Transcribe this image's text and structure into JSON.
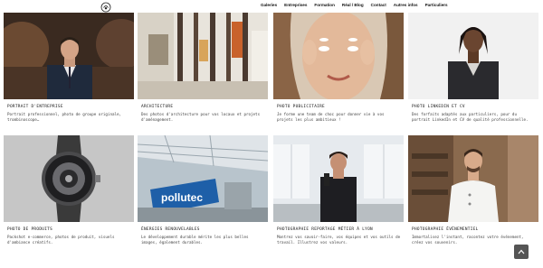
{
  "nav": [
    "Galeries",
    "Entreprises",
    "Formation",
    "Réal / Blog",
    "Contact",
    "Autres infos",
    "Particuliers"
  ],
  "icons": {
    "logo": "camera-logo-icon",
    "scroll_top": "chevron-up-icon"
  },
  "cards": [
    {
      "title": "PORTRAIT D'ENTREPRISE",
      "desc": "Portrait professionnel, photo de groupe originale, trombinoscope…"
    },
    {
      "title": "ARCHITECTURE",
      "desc": "Des photos d'architecture pour vos locaux et projets d'aménagement."
    },
    {
      "title": "PHOTO PUBLICITAIRE",
      "desc": "Je forme une team de choc pour donner vie à vos projets les plus ambitieux !"
    },
    {
      "title": "PHOTO LINKEDIN ET CV",
      "desc": "Des forfaits adaptés aux particuliers, pour du portrait LinkedIn et CV de qualité professionnelle."
    },
    {
      "title": "PHOTO DE PRODUITS",
      "desc": "Packshot e-commerce, photos de produit, visuels d'ambiance créatifs."
    },
    {
      "title": "ÉNERGIES RENOUVELABLES",
      "desc": "Le développement durable mérite les plus belles images, également durables."
    },
    {
      "title": "PHOTOGRAPHIE REPORTAGE MÉTIER À LYON",
      "desc": "Montrez vos savoir-faire, vos équipes et vos outils de travail. Illustrez vos valeurs."
    },
    {
      "title": "PHOTOGRAPHIE ÉVÉNEMENTIEL",
      "desc": "Immortalisez l'instant, racontez votre événement, créez vos souvenirs."
    }
  ],
  "banner_text": "pollutec"
}
